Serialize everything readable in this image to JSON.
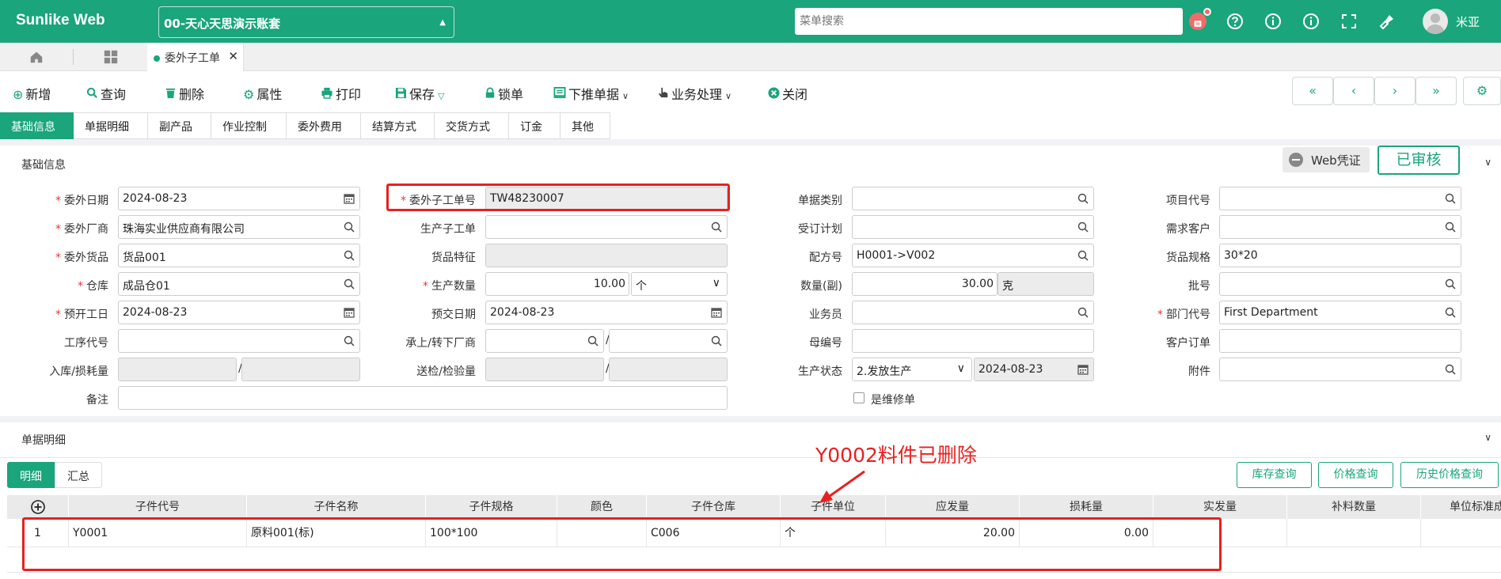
{
  "app": {
    "logo": "Sunlike Web",
    "account": "00-天心天思演示账套",
    "search_placeholder": "菜单搜索",
    "user": "米亚"
  },
  "tabs": {
    "open_tab": "委外子工单"
  },
  "toolbar": {
    "add": "新增",
    "query": "查询",
    "delete": "删除",
    "attrs": "属性",
    "print": "打印",
    "save": "保存",
    "lock": "锁单",
    "push_down": "下推单据",
    "business": "业务处理",
    "close": "关闭"
  },
  "form_tabs": [
    "基础信息",
    "单据明细",
    "副产品",
    "作业控制",
    "委外费用",
    "结算方式",
    "交货方式",
    "订金",
    "其他"
  ],
  "basic_section": {
    "title": "基础信息",
    "web_voucher": "Web凭证",
    "status": "已审核"
  },
  "form": {
    "outsource_date": {
      "label": "委外日期",
      "value": "2024-08-23"
    },
    "outsource_vendor": {
      "label": "委外厂商",
      "value": "珠海实业供应商有限公司"
    },
    "outsource_goods": {
      "label": "委外货品",
      "value": "货品001"
    },
    "warehouse": {
      "label": "仓库",
      "value": "成品仓01"
    },
    "planned_start": {
      "label": "预开工日",
      "value": "2024-08-23"
    },
    "process_code": {
      "label": "工序代号",
      "value": ""
    },
    "inbound_loss": {
      "label": "入库/损耗量"
    },
    "remark": {
      "label": "备注",
      "value": ""
    },
    "sub_order_no": {
      "label": "委外子工单号",
      "value": "TW48230007"
    },
    "prod_sub_order": {
      "label": "生产子工单",
      "value": ""
    },
    "goods_feature": {
      "label": "货品特征"
    },
    "prod_qty": {
      "label": "生产数量",
      "value": "10.00",
      "unit": "个"
    },
    "planned_delivery": {
      "label": "预交日期",
      "value": "2024-08-23"
    },
    "up_down_vendor": {
      "label": "承上/转下厂商"
    },
    "inspect_qty": {
      "label": "送检/检验量"
    },
    "doc_type": {
      "label": "单据类别",
      "value": ""
    },
    "order_plan": {
      "label": "受订计划",
      "value": ""
    },
    "formula_no": {
      "label": "配方号",
      "value": "H0001->V002"
    },
    "qty_sub": {
      "label": "数量(副)",
      "value": "30.00",
      "unit": "克"
    },
    "salesman": {
      "label": "业务员",
      "value": ""
    },
    "parent_no": {
      "label": "母编号",
      "value": ""
    },
    "prod_status": {
      "label": "生产状态",
      "value": "2.发放生产",
      "date": "2024-08-23"
    },
    "is_repair": {
      "label": "是维修单"
    },
    "project_code": {
      "label": "项目代号",
      "value": ""
    },
    "demand_customer": {
      "label": "需求客户",
      "value": ""
    },
    "goods_spec": {
      "label": "货品规格",
      "value": "30*20"
    },
    "batch_no": {
      "label": "批号",
      "value": ""
    },
    "dept_code": {
      "label": "部门代号",
      "value": "First Department"
    },
    "customer_order": {
      "label": "客户订单",
      "value": ""
    },
    "attachment": {
      "label": "附件",
      "value": ""
    }
  },
  "detail_section": {
    "title": "单据明细",
    "tab_detail": "明细",
    "tab_summary": "汇总",
    "stock_query": "库存查询",
    "price_query": "价格查询",
    "history_price_query": "历史价格查询"
  },
  "grid": {
    "headers": [
      "子件代号",
      "子件名称",
      "子件规格",
      "颜色",
      "子件仓库",
      "子件单位",
      "应发量",
      "损耗量",
      "实发量",
      "补料数量",
      "单位标准成"
    ],
    "rows": [
      {
        "no": "1",
        "code": "Y0001",
        "name": "原料001(标)",
        "spec": "100*100",
        "color": "",
        "warehouse": "C006",
        "unit": "个",
        "should_issue": "20.00",
        "loss": "0.00",
        "actual": "",
        "supplement": "",
        "std_cost": ""
      }
    ]
  },
  "annotation": "Y0002料件已删除",
  "colors": {
    "brand": "#1aa57c",
    "annotation": "#e8201f"
  }
}
